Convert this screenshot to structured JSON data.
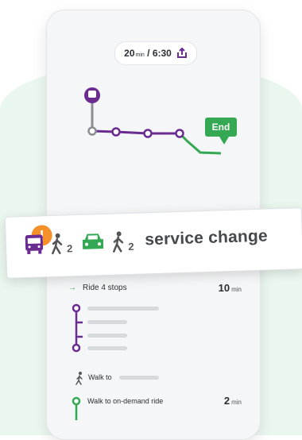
{
  "trip": {
    "duration_value": "20",
    "duration_unit": "min",
    "separator": " / ",
    "arrival_time": "6:30",
    "share_icon": "share-icon"
  },
  "map": {
    "end_label": "End",
    "route_color": "#6b2c91",
    "walk_color": "#34a853",
    "start_icon": "bus-icon"
  },
  "alert": {
    "bus_icon": "bus-icon",
    "walk_icon": "walking-person-icon",
    "car_icon": "car-icon",
    "warning_glyph": "!",
    "count_1": "2",
    "count_2": "2",
    "text": "service change",
    "colors": {
      "bus": "#6b2c91",
      "car": "#34a853",
      "warning": "#f5902a"
    }
  },
  "steps": [
    {
      "label": "Ride 4 stops",
      "value": "10",
      "unit": "min"
    },
    {
      "label": "Walk to"
    },
    {
      "label": "Walk to on-demand ride",
      "value": "2",
      "unit": "min"
    }
  ]
}
